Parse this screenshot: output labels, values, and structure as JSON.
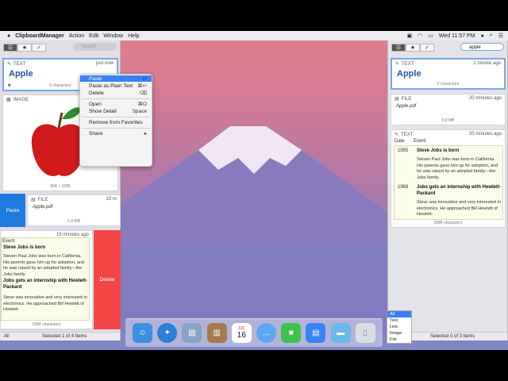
{
  "menubar": {
    "app": "ClipboardManager",
    "menus": [
      "Action",
      "Edit",
      "Window",
      "Help"
    ],
    "clock": "Wed 11:57 PM"
  },
  "left": {
    "search_placeholder": "Search",
    "card1": {
      "type": "TEXT",
      "when": "just now",
      "title": "Apple",
      "footer": "5 characters"
    },
    "card2": {
      "type": "IMAGE",
      "footer": "904 × 1085"
    },
    "card3": {
      "type": "FILE",
      "when": "19 m",
      "name": "Apple.pdf",
      "footer": "5,9 MB"
    },
    "card4": {
      "when": "19 minutes ago",
      "col": "Event",
      "e1_title": "Steve Jobs is born",
      "e1_text": "Steven Paul Jobs was born in California. His parents gave him up for adoption, and he was raised by an adopted family—the Jobs family.",
      "e2_title": "Jobs gets an internship with Hewlett-Packard",
      "e2_text": "Steve was innovative and very interested in electronics. He approached Bill Hewlett of Hewlett-",
      "footer": "2684 characters"
    },
    "paste_btn": "Paste",
    "delete_btn": "Delete",
    "status_filter": "All",
    "status": "Selected 1 of 4 Items"
  },
  "context_menu": [
    {
      "label": "Paste",
      "sc": "↩",
      "hl": true
    },
    {
      "label": "Paste as Plain Text",
      "sc": "⌘↩"
    },
    {
      "label": "Delete",
      "sc": "⌫"
    },
    {
      "label": "Open",
      "sc": "⌘O"
    },
    {
      "label": "Show Detail",
      "sc": "Space"
    },
    {
      "label": "Remove from Favorites",
      "sc": ""
    },
    {
      "label": "Share",
      "sc": "▸"
    }
  ],
  "right": {
    "search_value": "apple",
    "card1": {
      "type": "TEXT",
      "when": "1 minute ago",
      "title": "Apple",
      "footer": "5 characters"
    },
    "card2": {
      "type": "FILE",
      "when": "20 minutes ago",
      "name": "Apple.pdf",
      "footer": "5,9 MB"
    },
    "card3": {
      "type": "TEXT",
      "when": "20 minutes ago",
      "col1": "Date",
      "col2": "Event",
      "y1": "1955",
      "e1_title": "Steve Jobs is born",
      "e1_text": "Steven Paul Jobs was born in California. His parents gave him up for adoption, and he was raised by an adopted family—the Jobs family.",
      "y2": "1968",
      "e2_title": "Jobs gets an internship with Hewlett-Packard",
      "e2_text": "Steve was innovative and very interested in electronics. He approached Bill Hewlett of Hewlett-",
      "footer": "2684 characters"
    },
    "status_filter": "All",
    "status": "Selected 0 of 3 Items",
    "filter_options": [
      "All",
      "Text",
      "Link",
      "Image",
      "File"
    ]
  },
  "dock_calendar": {
    "month": "JUL",
    "day": "16"
  }
}
